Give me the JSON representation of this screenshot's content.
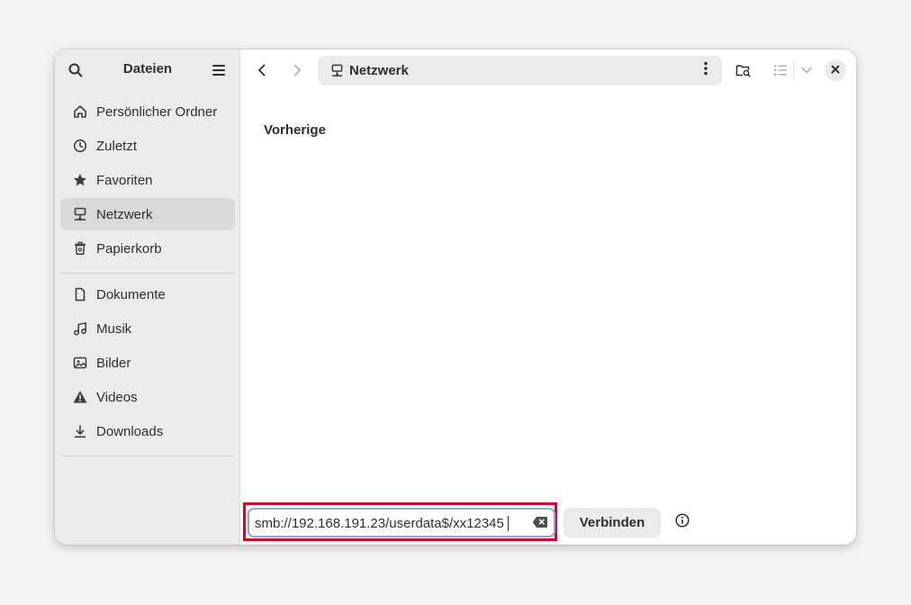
{
  "sidebar": {
    "title": "Dateien",
    "places": [
      {
        "label": "Persönlicher Ordner",
        "icon": "home-icon"
      },
      {
        "label": "Zuletzt",
        "icon": "clock-icon"
      },
      {
        "label": "Favoriten",
        "icon": "star-icon"
      },
      {
        "label": "Netzwerk",
        "icon": "network-icon",
        "active": true
      },
      {
        "label": "Papierkorb",
        "icon": "trash-icon"
      }
    ],
    "bookmarks": [
      {
        "label": "Dokumente",
        "icon": "document-icon"
      },
      {
        "label": "Musik",
        "icon": "music-icon"
      },
      {
        "label": "Bilder",
        "icon": "image-icon"
      },
      {
        "label": "Videos",
        "icon": "warning-icon"
      },
      {
        "label": "Downloads",
        "icon": "download-icon"
      }
    ]
  },
  "pathbar": {
    "location": "Netzwerk"
  },
  "main": {
    "section_heading": "Vorherige"
  },
  "connect_bar": {
    "address_value": "smb://192.168.191.23/userdata$/xx12345",
    "connect_label": "Verbinden"
  },
  "colors": {
    "sidebar_bg": "#ebebeb",
    "active_item_bg": "#d9d9d9",
    "highlight_border": "#c8102e",
    "focus_border": "#8aa7e0"
  }
}
